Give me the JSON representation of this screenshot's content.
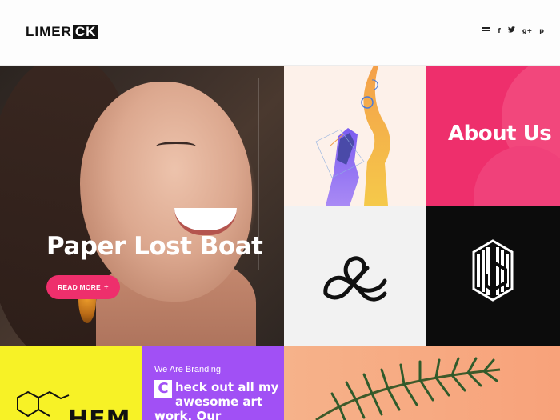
{
  "header": {
    "logo_part1": "LIMER",
    "logo_part2": "CK",
    "menu_icon": "hamburger-menu-icon",
    "social": [
      {
        "name": "facebook-icon",
        "glyph": "f"
      },
      {
        "name": "twitter-icon",
        "glyph": "❧"
      },
      {
        "name": "google-plus-icon",
        "glyph": "g+"
      },
      {
        "name": "pinterest-icon",
        "glyph": "p"
      }
    ]
  },
  "hero": {
    "title": "Paper Lost Boat",
    "button_label": "READ MORE",
    "button_icon": "+"
  },
  "tiles": {
    "about_title": "About Us"
  },
  "bottom": {
    "yellow_text": "HEM",
    "purple_kicker": "We Are Branding",
    "purple_dropcap": "C",
    "purple_body": "heck out all my awesome art work. Our Amazing"
  },
  "colors": {
    "accent_pink": "#ee2f6c",
    "yellow": "#f7f226",
    "purple": "#a150f5",
    "peach": "#f8a27a",
    "black": "#0c0c0c"
  }
}
